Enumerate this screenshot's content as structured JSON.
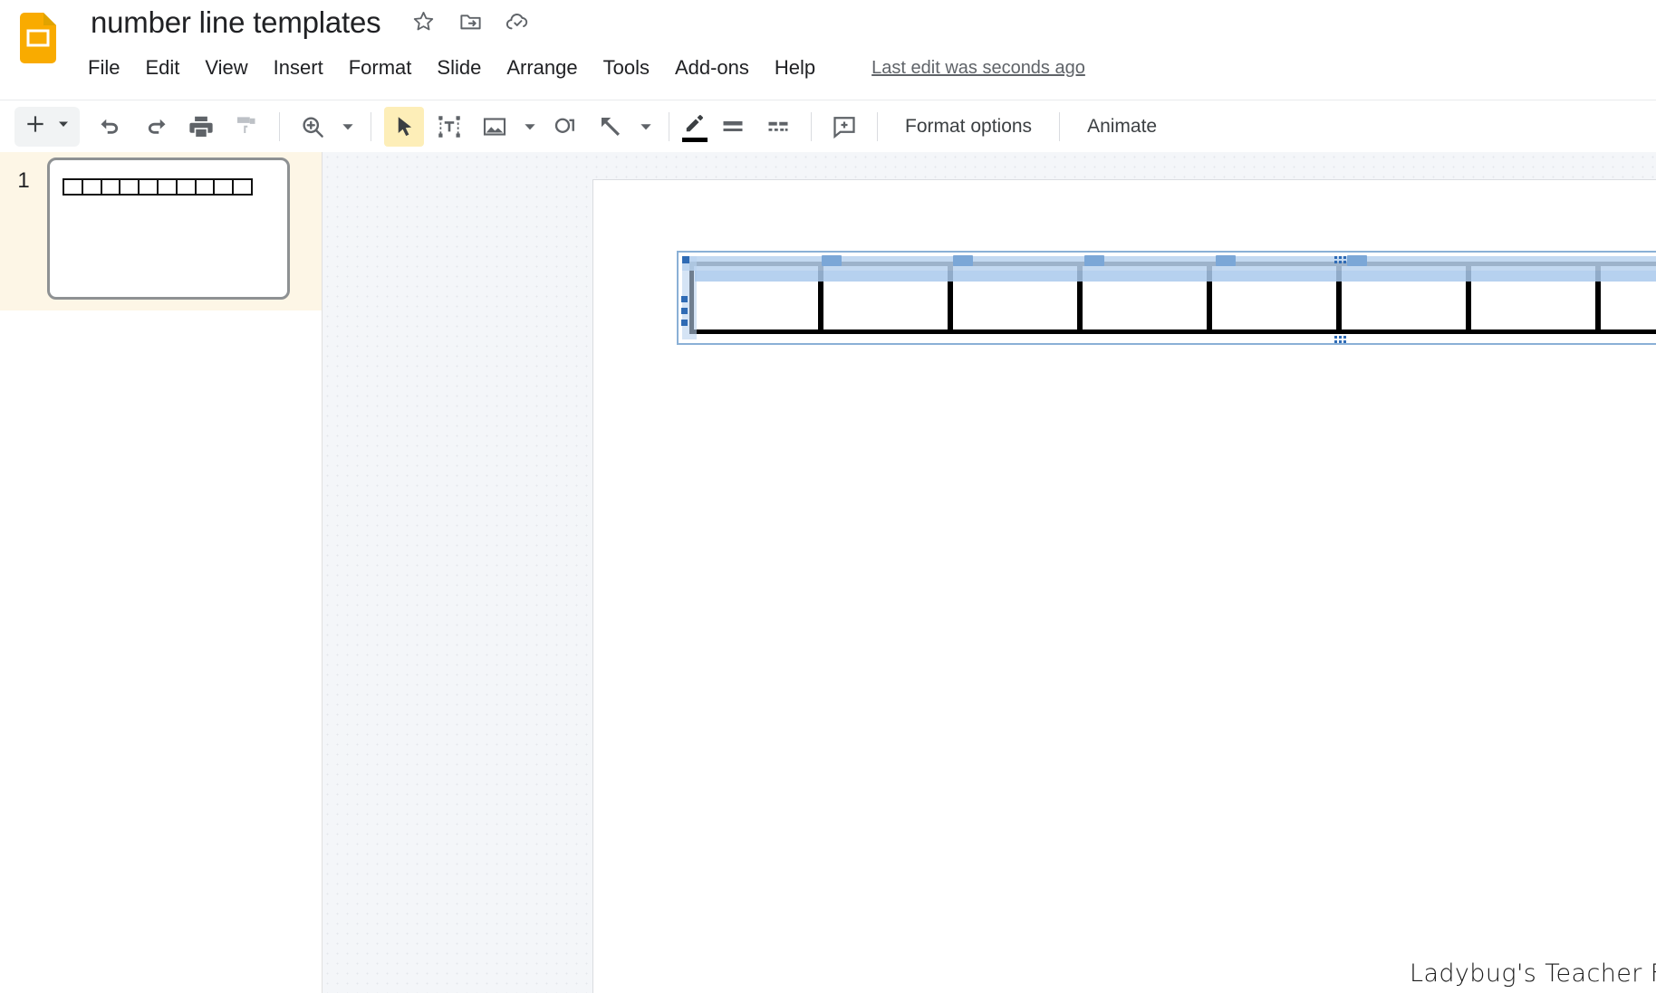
{
  "app": {
    "logo_icon": "google-slides-logo",
    "title": "number line templates"
  },
  "title_actions": [
    {
      "name": "star-icon",
      "glyph": "star"
    },
    {
      "name": "move-to-folder-icon",
      "glyph": "folder-move"
    },
    {
      "name": "cloud-saved-icon",
      "glyph": "cloud-check"
    }
  ],
  "menubar": {
    "items": [
      {
        "label": "File"
      },
      {
        "label": "Edit"
      },
      {
        "label": "View"
      },
      {
        "label": "Insert"
      },
      {
        "label": "Format"
      },
      {
        "label": "Slide"
      },
      {
        "label": "Arrange"
      },
      {
        "label": "Tools"
      },
      {
        "label": "Add-ons"
      },
      {
        "label": "Help"
      }
    ],
    "last_edit": "Last edit was seconds ago"
  },
  "toolbar": {
    "new_slide_label": "",
    "new_slide_icon": "plus-icon",
    "new_slide_caret": "chevron-down-icon",
    "undo_icon": "undo-icon",
    "redo_icon": "redo-icon",
    "print_icon": "print-icon",
    "paint_format_icon": "paint-format-icon",
    "zoom_icon": "zoom-in-icon",
    "zoom_caret": "chevron-down-icon",
    "select_icon": "select-cursor-icon",
    "textbox_icon": "text-box-icon",
    "image_icon": "insert-image-icon",
    "image_caret": "chevron-down-icon",
    "shape_icon": "shape-icon",
    "line_icon": "line-icon",
    "line_caret": "chevron-down-icon",
    "line_color_icon": "pen-line-color-icon",
    "line_color_value": "#000000",
    "line_weight_icon": "line-weight-icon",
    "line_dash_icon": "line-dash-icon",
    "comment_icon": "add-comment-icon",
    "format_options_label": "Format options",
    "animate_label": "Animate",
    "active_tool": "select-cursor-icon",
    "active_tool_highlight": "#fdeeb8"
  },
  "filmstrip": {
    "slides": [
      {
        "number": "1",
        "selected": true,
        "thumbnail": {
          "object": "number-line-table",
          "cells": 10
        }
      }
    ]
  },
  "canvas": {
    "background_color": "#f4f6f9",
    "slide_background": "#ffffff",
    "selected_object": {
      "type": "table",
      "columns": 10,
      "visible_columns": 6,
      "border_color": "#000000",
      "selection_color": "#b9d2ef",
      "handle_color": "#2f6bb5"
    },
    "footer_credit": "Ladybug's Teacher Files"
  }
}
